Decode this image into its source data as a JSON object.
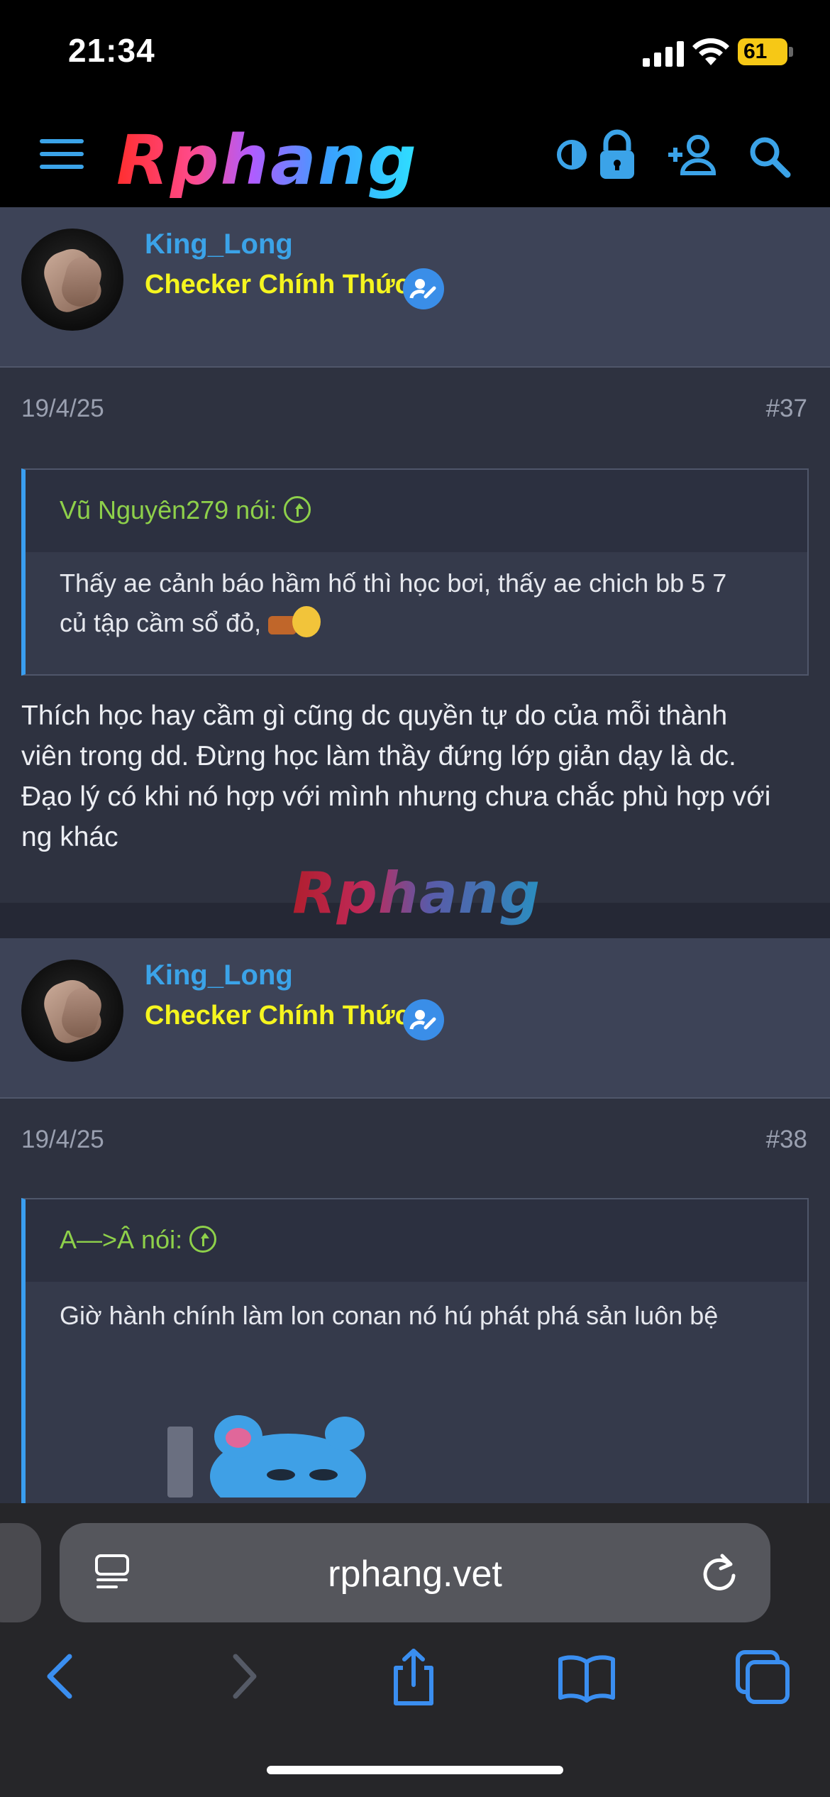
{
  "status_bar": {
    "time": "21:34",
    "battery": "61"
  },
  "header": {
    "logo": "Rphang",
    "icons": [
      "menu-icon",
      "theme-toggle-icon",
      "lock-icon",
      "add-user-icon",
      "search-icon"
    ],
    "accent_color": "#3ba3e8"
  },
  "posts": [
    {
      "username": "King_Long",
      "role": "Checker Chính Thức",
      "date": "19/4/25",
      "number": "#37",
      "quote": {
        "author": "Vũ Nguyên279 nói:",
        "text_line1": "Thấy ae cảnh báo hầm hố thì học bơi, thấy ae chich bb 5 7",
        "text_line2": "củ tập cầm sổ đỏ,"
      },
      "body_line1": "Thích học hay cầm gì cũng dc quyền tự do của mỗi thành",
      "body_line2": "viên trong dd. Đừng học làm thầy đứng lớp giản dạy là dc.",
      "body_line3": "Đạo lý có khi nó hợp với mình nhưng chưa chắc phù hợp với",
      "body_line4": "ng khác"
    },
    {
      "username": "King_Long",
      "role": "Checker Chính Thức",
      "date": "19/4/25",
      "number": "#38",
      "quote": {
        "author": "A—>Â nói:",
        "text_line1": "Giờ hành chính làm lon conan nó hú phát phá sản luôn bệ"
      }
    }
  ],
  "watermark": "Rphang",
  "browser": {
    "url": "rphang.vet",
    "icons": [
      "page-menu-icon",
      "reload-icon",
      "back-icon",
      "forward-icon",
      "share-icon",
      "bookmarks-icon",
      "tabs-icon"
    ]
  }
}
